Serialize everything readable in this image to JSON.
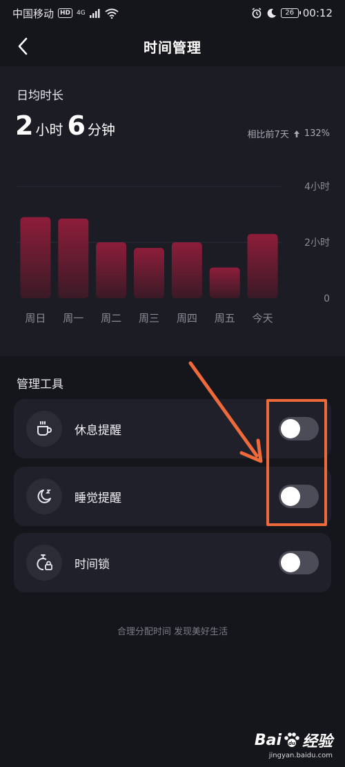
{
  "status_bar": {
    "carrier": "中国移动",
    "hd_badge": "HD",
    "network": "4G",
    "battery": "26",
    "time": "00:12"
  },
  "nav": {
    "title": "时间管理",
    "back_icon": "chevron-left-icon"
  },
  "summary": {
    "label": "日均时长",
    "hours_value": "2",
    "hours_unit": "小时",
    "minutes_value": "6",
    "minutes_unit": "分钟",
    "compare_text": "相比前7天",
    "compare_percent": "132%",
    "compare_direction": "up"
  },
  "chart_data": {
    "type": "bar",
    "categories": [
      "周日",
      "周一",
      "周二",
      "周三",
      "周四",
      "周五",
      "今天"
    ],
    "values": [
      2.9,
      2.85,
      2.0,
      1.8,
      2.0,
      1.1,
      2.3
    ],
    "y_tick_labels": [
      "4小时",
      "2小时",
      "0"
    ],
    "y_ticks": [
      4,
      2,
      0
    ],
    "ylim": [
      0,
      4
    ],
    "grid": true,
    "bar_color_top": "#8e1d3a",
    "bar_color_bottom": "#3a1a26"
  },
  "tools": {
    "title": "管理工具",
    "items": [
      {
        "label": "休息提醒",
        "icon": "coffee-cup-icon",
        "enabled": false
      },
      {
        "label": "睡觉提醒",
        "icon": "moon-sleep-icon",
        "enabled": false
      },
      {
        "label": "时间锁",
        "icon": "stopwatch-lock-icon",
        "enabled": false
      }
    ],
    "slogan": "合理分配时间 发现美好生活"
  },
  "annotation": {
    "color": "#ee6a3a"
  },
  "watermark": {
    "logo_text": "Bai",
    "logo_text_2": "经验",
    "url": "jingyan.baidu.com"
  }
}
